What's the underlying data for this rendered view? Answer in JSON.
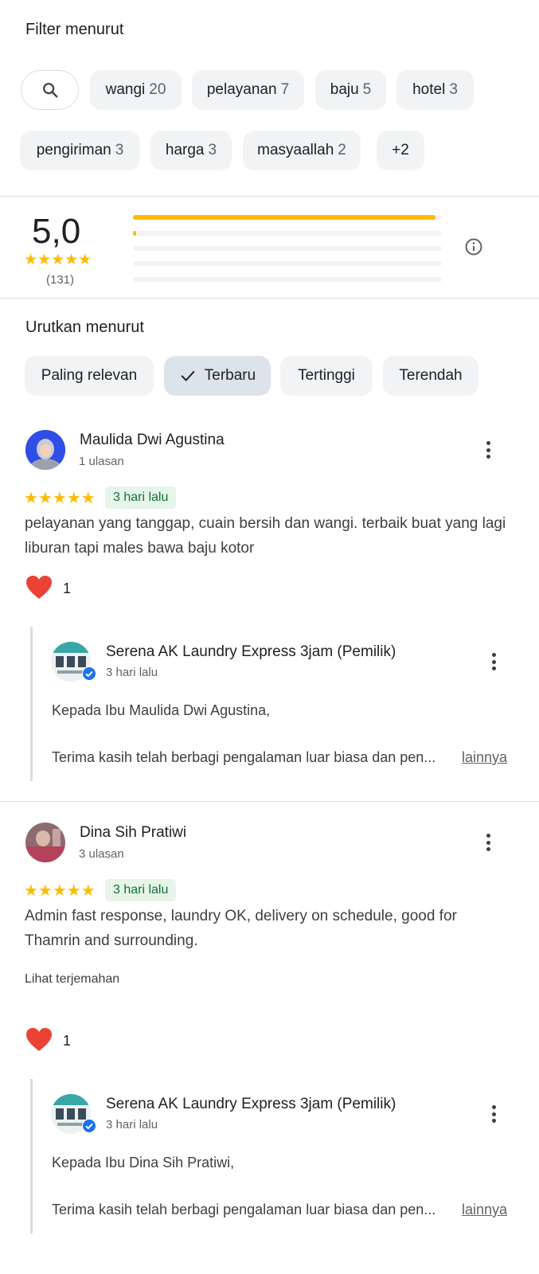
{
  "filter": {
    "title": "Filter menurut",
    "chips": [
      {
        "label": "wangi",
        "count": "20"
      },
      {
        "label": "pelayanan",
        "count": "7"
      },
      {
        "label": "baju",
        "count": "5"
      },
      {
        "label": "hotel",
        "count": "3"
      },
      {
        "label": "pengiriman",
        "count": "3"
      },
      {
        "label": "harga",
        "count": "3"
      },
      {
        "label": "masyaallah",
        "count": "2"
      },
      {
        "label": "+2",
        "count": ""
      }
    ]
  },
  "summary": {
    "rating": "5,0",
    "stars": "★★★★★",
    "total": "(131)",
    "distribution": [
      {
        "stars": 5,
        "fraction": 0.98
      },
      {
        "stars": 4,
        "fraction": 0.01
      },
      {
        "stars": 3,
        "fraction": 0
      },
      {
        "stars": 2,
        "fraction": 0
      },
      {
        "stars": 1,
        "fraction": 0
      }
    ]
  },
  "sort": {
    "title": "Urutkan menurut",
    "options": [
      "Paling relevan",
      "Terbaru",
      "Tertinggi",
      "Terendah"
    ],
    "selected": "Terbaru"
  },
  "reviews": [
    {
      "name": "Maulida Dwi Agustina",
      "meta": "1 ulasan",
      "stars": "★★★★★",
      "time": "3 hari lalu",
      "text": "pelayanan yang tanggap, cuain bersih dan wangi. terbaik buat yang lagi liburan tapi males bawa baju kotor",
      "likes": "1",
      "reply": {
        "name": "Serena AK Laundry Express 3jam (Pemilik)",
        "time": "3 hari lalu",
        "greeting": "Kepada Ibu Maulida Dwi Agustina,",
        "body": "Terima kasih telah berbagi pengalaman luar biasa dan pen...",
        "more": "lainnya"
      }
    },
    {
      "name": "Dina Sih Pratiwi",
      "meta": "3 ulasan",
      "stars": "★★★★★",
      "time": "3 hari lalu",
      "text": "Admin fast response, laundry OK, delivery on schedule, good for Thamrin and surrounding.",
      "translate": "Lihat terjemahan",
      "likes": "1",
      "reply": {
        "name": "Serena AK Laundry Express 3jam (Pemilik)",
        "time": "3 hari lalu",
        "greeting": "Kepada Ibu Dina Sih Pratiwi,",
        "body": "Terima kasih telah berbagi pengalaman luar biasa dan pen...",
        "more": "lainnya"
      }
    }
  ],
  "colors": {
    "star": "#fbbc04",
    "chip_bg": "#f1f3f4",
    "selected_chip_bg": "#dde3ea",
    "badge_bg": "#e6f4ea",
    "badge_text": "#137333",
    "heart": "#ea4335",
    "verified": "#1a73e8"
  }
}
